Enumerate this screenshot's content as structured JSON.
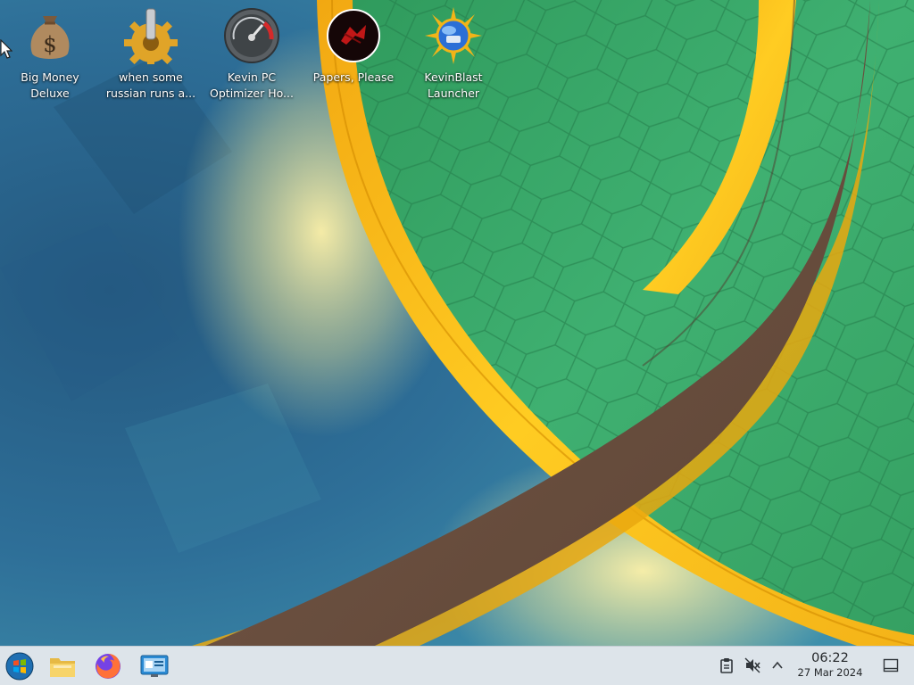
{
  "desktop": {
    "icons": [
      {
        "label": "Big Money\nDeluxe",
        "icon": "money-bag-icon"
      },
      {
        "label": "when some\nrussian runs a...",
        "icon": "gear-icon"
      },
      {
        "label": "Kevin PC\nOptimizer Ho...",
        "icon": "speedometer-icon"
      },
      {
        "label": "Papers, Please",
        "icon": "papers-please-icon"
      },
      {
        "label": "KevinBlast\nLauncher",
        "icon": "kevinblast-icon"
      }
    ]
  },
  "taskbar": {
    "pinned": [
      {
        "icon": "start-menu-icon"
      },
      {
        "icon": "file-manager-icon"
      },
      {
        "icon": "firefox-icon"
      },
      {
        "icon": "system-settings-icon"
      }
    ],
    "tray": {
      "icons": [
        "clipboard-icon",
        "volume-muted-icon",
        "chevron-up-icon"
      ],
      "time": "06:22",
      "date": "27 Mar 2024"
    }
  },
  "colors": {
    "wallpaper_blue": "#2f6f9a",
    "wallpaper_green": "#39a366",
    "ring_gold": "#f5b915",
    "ring_brown": "#6d5342",
    "taskbar_bg": "#dde4ea",
    "text_dark": "#232629"
  }
}
